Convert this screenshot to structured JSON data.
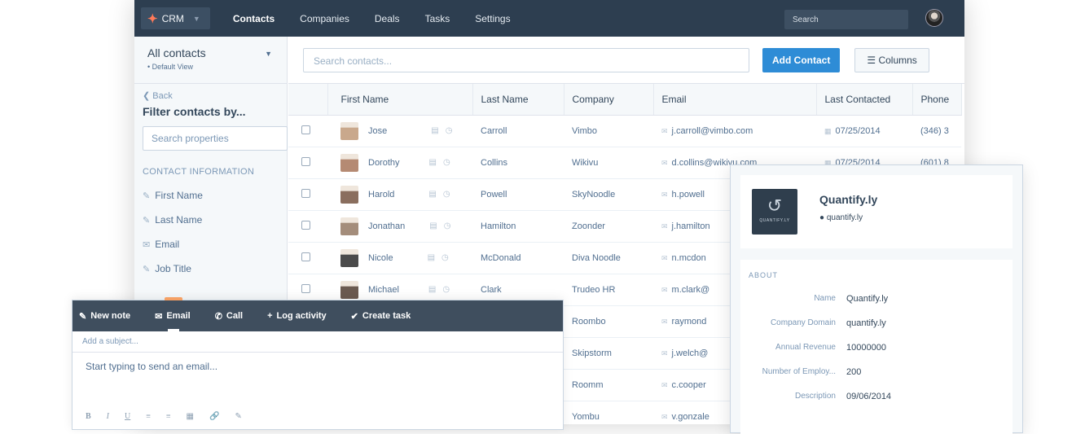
{
  "nav": {
    "brand": "CRM",
    "links": [
      "Contacts",
      "Companies",
      "Deals",
      "Tasks",
      "Settings"
    ],
    "search_placeholder": "Search"
  },
  "view": {
    "title": "All contacts",
    "subtitle": "• Default View"
  },
  "filter": {
    "back": "Back",
    "title": "Filter contacts by...",
    "search_placeholder": "Search properties",
    "section": "CONTACT INFORMATION",
    "props": [
      "First Name",
      "Last Name",
      "Email",
      "Job Title"
    ]
  },
  "toolbar": {
    "search_placeholder": "Search contacts...",
    "add": "Add Contact",
    "columns": "Columns"
  },
  "table": {
    "headers": [
      "First Name",
      "Last Name",
      "Company",
      "Email",
      "Last Contacted",
      "Phone"
    ],
    "rows": [
      {
        "first": "Jose",
        "last": "Carroll",
        "company": "Vimbo",
        "email": "j.carroll@vimbo.com",
        "date": "07/25/2014",
        "phone": "(346) 3"
      },
      {
        "first": "Dorothy",
        "last": "Collins",
        "company": "Wikivu",
        "email": "d.collins@wikivu.com",
        "date": "07/25/2014",
        "phone": "(601) 8"
      },
      {
        "first": "Harold",
        "last": "Powell",
        "company": "SkyNoodle",
        "email": "h.powell",
        "date": "",
        "phone": ""
      },
      {
        "first": "Jonathan",
        "last": "Hamilton",
        "company": "Zoonder",
        "email": "j.hamilton",
        "date": "",
        "phone": ""
      },
      {
        "first": "Nicole",
        "last": "McDonald",
        "company": "Diva Noodle",
        "email": "n.mcdon",
        "date": "",
        "phone": ""
      },
      {
        "first": "Michael",
        "last": "Clark",
        "company": "Trudeo HR",
        "email": "m.clark@",
        "date": "",
        "phone": ""
      },
      {
        "first": "",
        "last": "",
        "company": "Roombo",
        "email": "raymond",
        "date": "",
        "phone": ""
      },
      {
        "first": "",
        "last": "",
        "company": "Skipstorm",
        "email": "j.welch@",
        "date": "",
        "phone": ""
      },
      {
        "first": "",
        "last": "",
        "company": "Roomm",
        "email": "c.cooper",
        "date": "",
        "phone": ""
      },
      {
        "first": "",
        "last": "",
        "company": "Yombu",
        "email": "v.gonzale",
        "date": "",
        "phone": ""
      }
    ]
  },
  "composer": {
    "tabs": [
      "New note",
      "Email",
      "Call",
      "Log activity",
      "Create task"
    ],
    "subject_placeholder": "Add a subject...",
    "body_placeholder": "Start typing to send an email...",
    "format": [
      "B",
      "I",
      "U"
    ]
  },
  "company": {
    "name": "Quantify.ly",
    "domain": "quantify.ly",
    "logo_text": "QUANTIFY.LY",
    "about_title": "ABOUT",
    "fields": [
      {
        "label": "Name",
        "value": "Quantify.ly"
      },
      {
        "label": "Company Domain",
        "value": "quantify.ly"
      },
      {
        "label": "Annual Revenue",
        "value": "10000000"
      },
      {
        "label": "Number of Employ...",
        "value": "200"
      },
      {
        "label": "Description",
        "value": "09/06/2014"
      }
    ]
  },
  "colors": {
    "nav": "#2d3e50",
    "accent": "#ff7a59",
    "primary_button": "#2e8cd6"
  }
}
